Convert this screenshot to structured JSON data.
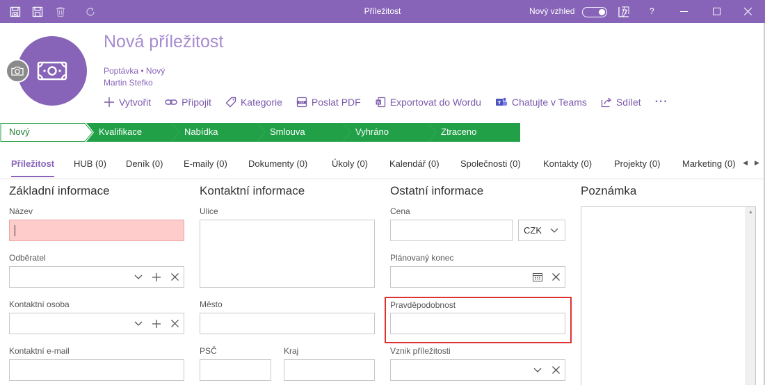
{
  "window": {
    "title": "Příležitost",
    "toggle_label": "Nový vzhled",
    "help": "?",
    "colors": {
      "accent": "#8764b8",
      "stage_green": "#21a048",
      "error_fill": "#ffcccc",
      "highlight": "#e03030"
    }
  },
  "header": {
    "title": "Nová příležitost",
    "subtitle": "Poptávka • Nový",
    "owner": "Martin Stefko",
    "actions": [
      {
        "label": "Vytvořit",
        "icon": "plus-icon"
      },
      {
        "label": "Připojit",
        "icon": "link-icon"
      },
      {
        "label": "Kategorie",
        "icon": "tag-icon"
      },
      {
        "label": "Poslat PDF",
        "icon": "pdf-icon"
      },
      {
        "label": "Exportovat do Wordu",
        "icon": "word-icon"
      },
      {
        "label": "Chatujte v Teams",
        "icon": "teams-icon"
      },
      {
        "label": "Sdílet",
        "icon": "share-icon"
      },
      {
        "label": "···",
        "icon": "more-icon"
      }
    ]
  },
  "stages": [
    {
      "label": "Nový",
      "active": true
    },
    {
      "label": "Kvalifikace"
    },
    {
      "label": "Nabídka"
    },
    {
      "label": "Smlouva"
    },
    {
      "label": "Vyhráno"
    },
    {
      "label": "Ztraceno"
    }
  ],
  "tabs": [
    {
      "label": "Příležitost",
      "active": true
    },
    {
      "label": "HUB (0)"
    },
    {
      "label": "Deník (0)"
    },
    {
      "label": "E-maily (0)"
    },
    {
      "label": "Dokumenty (0)"
    },
    {
      "label": "Úkoly (0)"
    },
    {
      "label": "Kalendář (0)"
    },
    {
      "label": "Společnosti (0)"
    },
    {
      "label": "Kontakty (0)"
    },
    {
      "label": "Projekty (0)"
    },
    {
      "label": "Marketing (0)"
    }
  ],
  "sections": {
    "basic": {
      "title": "Základní informace",
      "fields": {
        "name": {
          "label": "Název",
          "value": ""
        },
        "customer": {
          "label": "Odběratel",
          "value": ""
        },
        "contact_person": {
          "label": "Kontaktní osoba",
          "value": ""
        },
        "contact_email": {
          "label": "Kontaktní e-mail",
          "value": ""
        }
      }
    },
    "contact": {
      "title": "Kontaktní informace",
      "fields": {
        "street": {
          "label": "Ulice",
          "value": ""
        },
        "city": {
          "label": "Město",
          "value": ""
        },
        "zip": {
          "label": "PSČ",
          "value": ""
        },
        "region": {
          "label": "Kraj",
          "value": ""
        }
      }
    },
    "other": {
      "title": "Ostatní informace",
      "fields": {
        "price": {
          "label": "Cena",
          "value": ""
        },
        "currency": {
          "label": "",
          "value": "CZK"
        },
        "planned_end": {
          "label": "Plánovaný konec",
          "value": ""
        },
        "probability": {
          "label": "Pravděpodobnost",
          "value": ""
        },
        "origin": {
          "label": "Vznik příležitosti",
          "value": ""
        }
      }
    },
    "notes": {
      "title": "Poznámka",
      "value": ""
    }
  }
}
